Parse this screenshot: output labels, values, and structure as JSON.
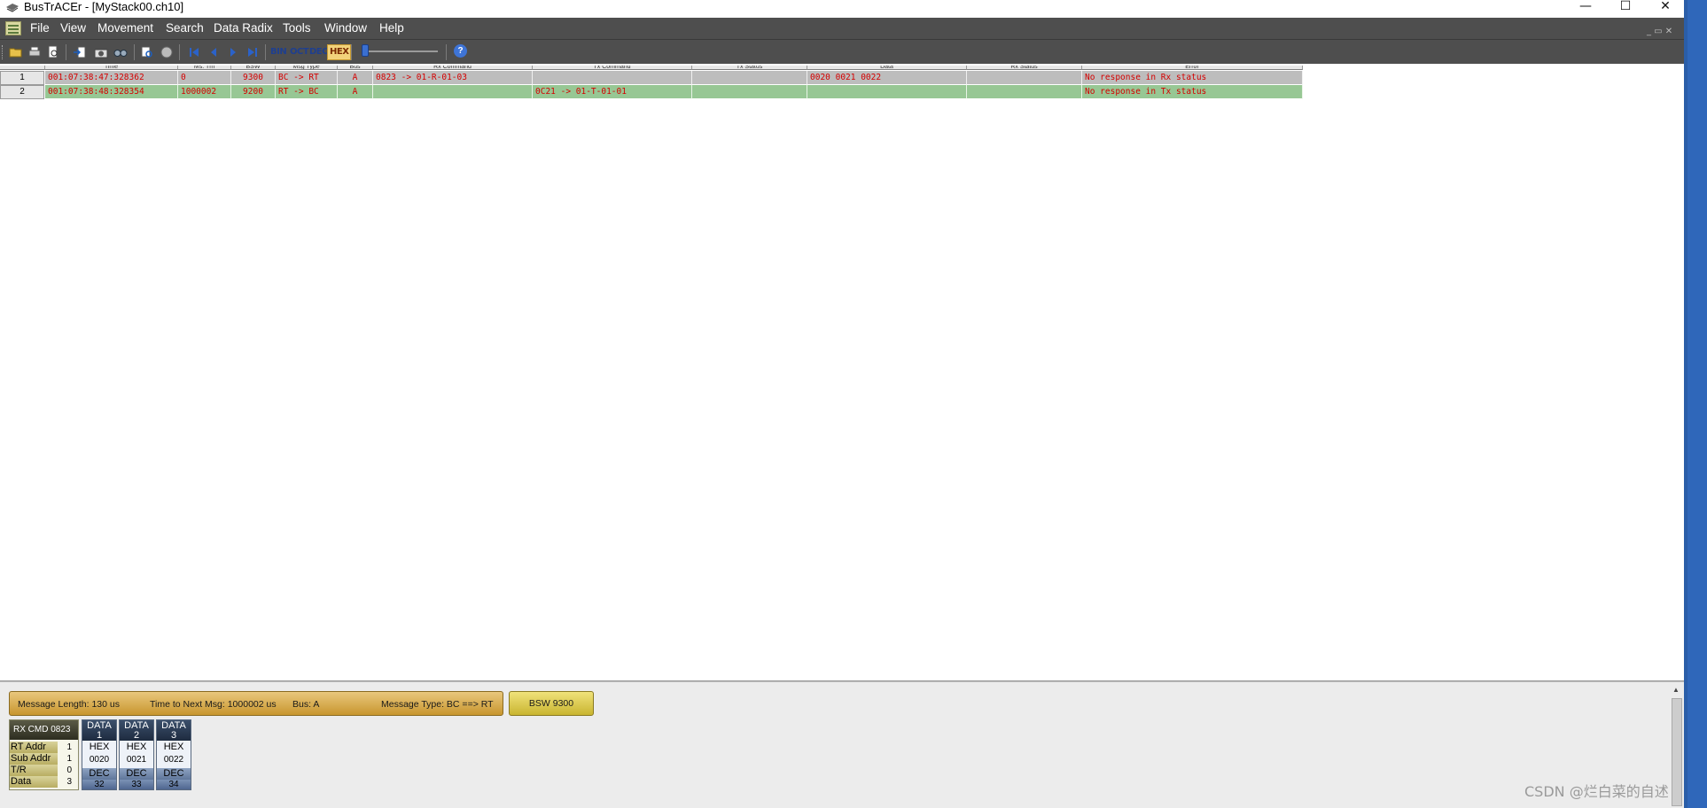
{
  "window": {
    "title": "BusTrACEr - [MyStack00.ch10]",
    "min_glyph": "—",
    "max_glyph": "☐",
    "close_glyph": "✕",
    "mdi_controls": "_ ▭ ✕"
  },
  "menu": [
    "File",
    "View",
    "Movement",
    "Search",
    "Data Radix",
    "Tools",
    "Window",
    "Help"
  ],
  "toolbar": {
    "radix_buttons": [
      "BIN",
      "OCT",
      "DEC",
      "HEX"
    ],
    "active_radix": "HEX",
    "help_label": "?",
    "icons": [
      "open-icon",
      "print-icon",
      "print-preview-icon",
      "export-icon",
      "camera-icon",
      "find-icon",
      "filter-icon",
      "stop-icon",
      "first-icon",
      "prev-icon",
      "next-icon",
      "last-icon"
    ]
  },
  "table": {
    "headers": [
      "",
      "Time",
      "Ms. Tm",
      "BSW",
      "Msg Type",
      "Bus",
      "Rx Command",
      "Tx Command",
      "Tx Status",
      "Data",
      "Rx Status",
      "Error"
    ],
    "rows": [
      {
        "num": "1",
        "time": "001:07:38:47:328362",
        "gap": "0",
        "bsw": "9300",
        "msg_type": "BC -> RT",
        "bus": "A",
        "rx_cmd": "0823 -> 01-R-01-03",
        "tx_cmd": "",
        "tx_status": "",
        "data": "0020 0021 0022",
        "rx_status": "",
        "error": "No response in Rx status"
      },
      {
        "num": "2",
        "time": "001:07:38:48:328354",
        "gap": "1000002",
        "bsw": "9200",
        "msg_type": "RT -> BC",
        "bus": "A",
        "rx_cmd": "",
        "tx_cmd": "0C21 -> 01-T-01-01",
        "tx_status": "",
        "data": "",
        "rx_status": "",
        "error": "No response in Tx status"
      }
    ]
  },
  "detail": {
    "message_length": "Message Length: 130 us",
    "time_to_next": "Time to Next Msg: 1000002 us",
    "bus": "Bus: A",
    "message_type": "Message Type: BC ==> RT",
    "bsw_button": "BSW 9300",
    "rx_cmd_title": "RX CMD  0823",
    "cmd_fields": [
      {
        "label": "RT Addr",
        "value": "1"
      },
      {
        "label": "Sub Addr",
        "value": "1"
      },
      {
        "label": "T/R",
        "value": "0"
      },
      {
        "label": "Data",
        "value": "3"
      }
    ],
    "data_words": [
      {
        "title": "DATA",
        "index": "1",
        "hex_label": "HEX",
        "hex": "0020",
        "dec_label": "DEC",
        "dec": "32"
      },
      {
        "title": "DATA",
        "index": "2",
        "hex_label": "HEX",
        "hex": "0021",
        "dec_label": "DEC",
        "dec": "33"
      },
      {
        "title": "DATA",
        "index": "3",
        "hex_label": "HEX",
        "hex": "0022",
        "dec_label": "DEC",
        "dec": "34"
      }
    ]
  },
  "watermark": "CSDN @烂白菜的自述",
  "colors": {
    "menubar": "#4e4e4e",
    "row1_bg": "#bdbdbd",
    "row2_bg": "#97c794",
    "row_text": "#d40000",
    "info_bar": "#d9b257",
    "bsw_button": "#e0cc50"
  }
}
